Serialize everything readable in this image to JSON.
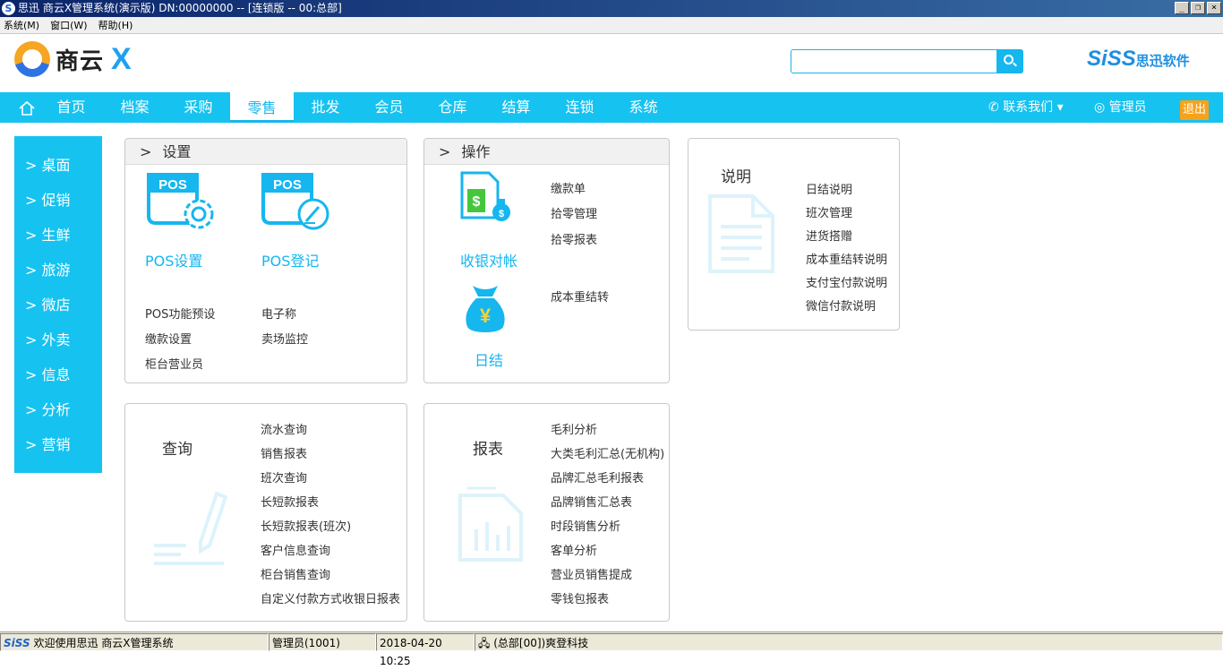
{
  "window": {
    "title": "思迅 商云X管理系统(演示版) DN:00000000 -- [连锁版 -- 00:总部]",
    "app_icon": "S"
  },
  "menubar": [
    "系统(M)",
    "窗口(W)",
    "帮助(H)"
  ],
  "header": {
    "logo_text": "商云",
    "logo_x": "X",
    "search_placeholder": "",
    "brand_main": "SiSS",
    "brand_sub": "思迅软件"
  },
  "nav": {
    "items": [
      "首页",
      "档案",
      "采购",
      "零售",
      "批发",
      "会员",
      "仓库",
      "结算",
      "连锁",
      "系统"
    ],
    "active_index": 3,
    "contact": "联系我们",
    "user": "管理员",
    "logout": "退出",
    "accent_color": "#16c2f0"
  },
  "sidebar": {
    "items": [
      "> 桌面",
      "> 促销",
      "> 生鲜",
      "> 旅游",
      "> 微店",
      "> 外卖",
      "> 信息",
      "> 分析",
      "> 营销"
    ]
  },
  "settings_panel": {
    "header_gt": ">",
    "title": "设置",
    "pos_settings": "POS设置",
    "pos_register": "POS登记",
    "pos_badge": "POS",
    "links_left": [
      "POS功能预设",
      "缴款设置",
      "柜台营业员"
    ],
    "links_right": [
      "电子称",
      "卖场监控"
    ]
  },
  "operation_panel": {
    "header_gt": ">",
    "title": "操作",
    "cash_check": "收银对帐",
    "daily_close": "日结",
    "links_top": [
      "缴款单",
      "拾零管理",
      "拾零报表"
    ],
    "link_bottom": "成本重结转"
  },
  "notes_panel": {
    "title": "说明",
    "links": [
      "日结说明",
      "班次管理",
      "进货搭赠",
      "成本重结转说明",
      "支付宝付款说明",
      "微信付款说明"
    ]
  },
  "query_panel": {
    "title": "查询",
    "links": [
      "流水查询",
      "销售报表",
      "班次查询",
      "长短款报表",
      "长短款报表(班次)",
      "客户信息查询",
      "柜台销售查询",
      "自定义付款方式收银日报表"
    ]
  },
  "report_panel": {
    "title": "报表",
    "links": [
      "毛利分析",
      "大类毛利汇总(无机构)",
      "品牌汇总毛利报表",
      "品牌销售汇总表",
      "时段销售分析",
      "客单分析",
      "营业员销售提成",
      "零钱包报表"
    ]
  },
  "statusbar": {
    "logo": "SiSS",
    "welcome": "欢迎使用思迅 商云X管理系统",
    "user": "管理员(1001)",
    "datetime": "2018-04-20 10:25",
    "org": "(总部[00])爽登科技"
  }
}
